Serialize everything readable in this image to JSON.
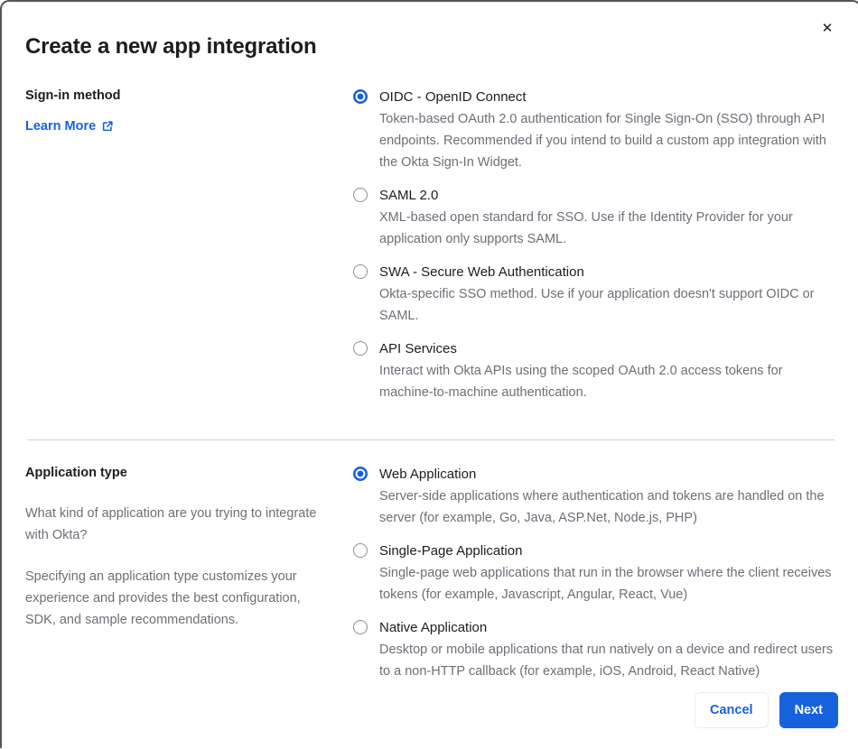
{
  "dialog": {
    "title": "Create a new app integration",
    "close_glyph": "✕"
  },
  "colors": {
    "accent_blue": "#1662dd",
    "text_dark": "#1d1d21",
    "text_gray": "#6e6e78"
  },
  "sections": [
    {
      "label": "Sign-in method",
      "link_label": "Learn More",
      "options": [
        {
          "label": "OIDC - OpenID Connect",
          "description": "Token-based OAuth 2.0 authentication for Single Sign-On (SSO) through API endpoints. Recommended if you intend to build a custom app integration with the Okta Sign-In Widget.",
          "selected": true
        },
        {
          "label": "SAML 2.0",
          "description": "XML-based open standard for SSO. Use if the Identity Provider for your application only supports SAML.",
          "selected": false
        },
        {
          "label": "SWA - Secure Web Authentication",
          "description": "Okta-specific SSO method. Use if your application doesn't support OIDC or SAML.",
          "selected": false
        },
        {
          "label": "API Services",
          "description": "Interact with Okta APIs using the scoped OAuth 2.0 access tokens for machine-to-machine authentication.",
          "selected": false
        }
      ]
    },
    {
      "label": "Application type",
      "paragraphs": [
        "What kind of application are you trying to integrate with Okta?",
        "Specifying an application type customizes your experience and provides the best configuration, SDK, and sample recommendations."
      ],
      "options": [
        {
          "label": "Web Application",
          "description": "Server-side applications where authentication and tokens are handled on the server (for example, Go, Java, ASP.Net, Node.js, PHP)",
          "selected": true
        },
        {
          "label": "Single-Page Application",
          "description": "Single-page web applications that run in the browser where the client receives tokens (for example, Javascript, Angular, React, Vue)",
          "selected": false
        },
        {
          "label": "Native Application",
          "description": "Desktop or mobile applications that run natively on a device and redirect users to a non-HTTP callback (for example, iOS, Android, React Native)",
          "selected": false
        }
      ]
    }
  ],
  "footer": {
    "cancel_label": "Cancel",
    "next_label": "Next"
  }
}
